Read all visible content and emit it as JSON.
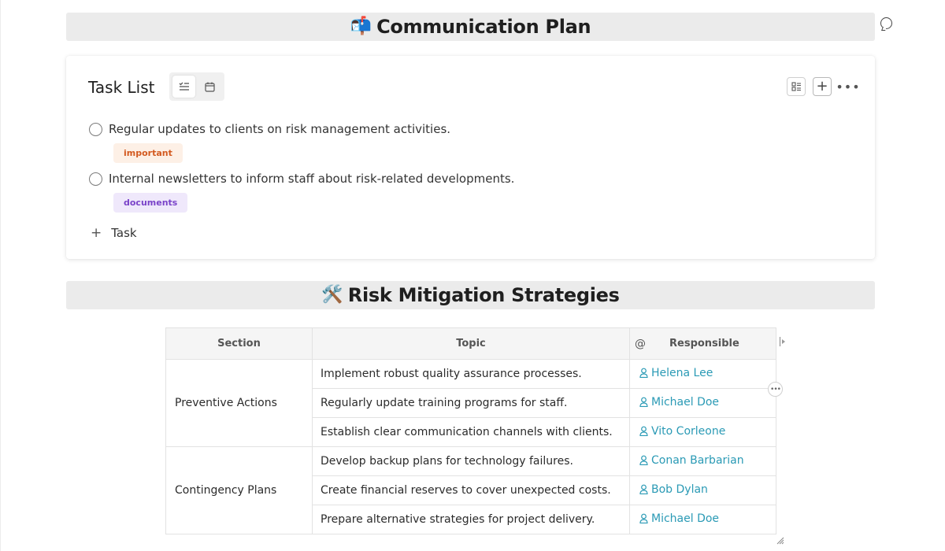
{
  "communication": {
    "emoji": "📬",
    "title": "Communication Plan"
  },
  "task_list": {
    "title": "Task List",
    "tasks": [
      {
        "text": "Regular updates to clients on risk management activities.",
        "tag": "important"
      },
      {
        "text": "Internal newsletters to inform staff about risk-related developments.",
        "tag": "documents"
      }
    ],
    "add_task_label": "Task"
  },
  "risk": {
    "emoji": "🛠️",
    "title": "Risk Mitigation Strategies",
    "headers": {
      "section": "Section",
      "topic": "Topic",
      "at": "@",
      "responsible": "Responsible"
    },
    "groups": [
      {
        "section": "Preventive Actions",
        "rows": [
          {
            "topic": "Implement robust quality assurance processes.",
            "responsible": "Helena Lee"
          },
          {
            "topic": "Regularly update training programs for staff.",
            "responsible": "Michael Doe"
          },
          {
            "topic": "Establish clear communication channels with clients.",
            "responsible": "Vito Corleone"
          }
        ]
      },
      {
        "section": "Contingency Plans",
        "rows": [
          {
            "topic": "Develop backup plans for technology failures.",
            "responsible": "Conan Barbarian"
          },
          {
            "topic": "Create financial reserves to cover unexpected costs.",
            "responsible": "Bob Dylan"
          },
          {
            "topic": "Prepare alternative strategies for project delivery.",
            "responsible": "Michael Doe"
          }
        ]
      }
    ]
  },
  "colors": {
    "accent_link": "#2a9ab5",
    "tag_important": "#d35a20",
    "tag_documents": "#7a43c9"
  },
  "icons": [
    "comment-icon",
    "checklist-view-icon",
    "calendar-view-icon",
    "layout-icon",
    "plus-icon",
    "more-icon",
    "person-icon",
    "expand-column-icon",
    "row-more-icon",
    "resize-handle-icon"
  ]
}
